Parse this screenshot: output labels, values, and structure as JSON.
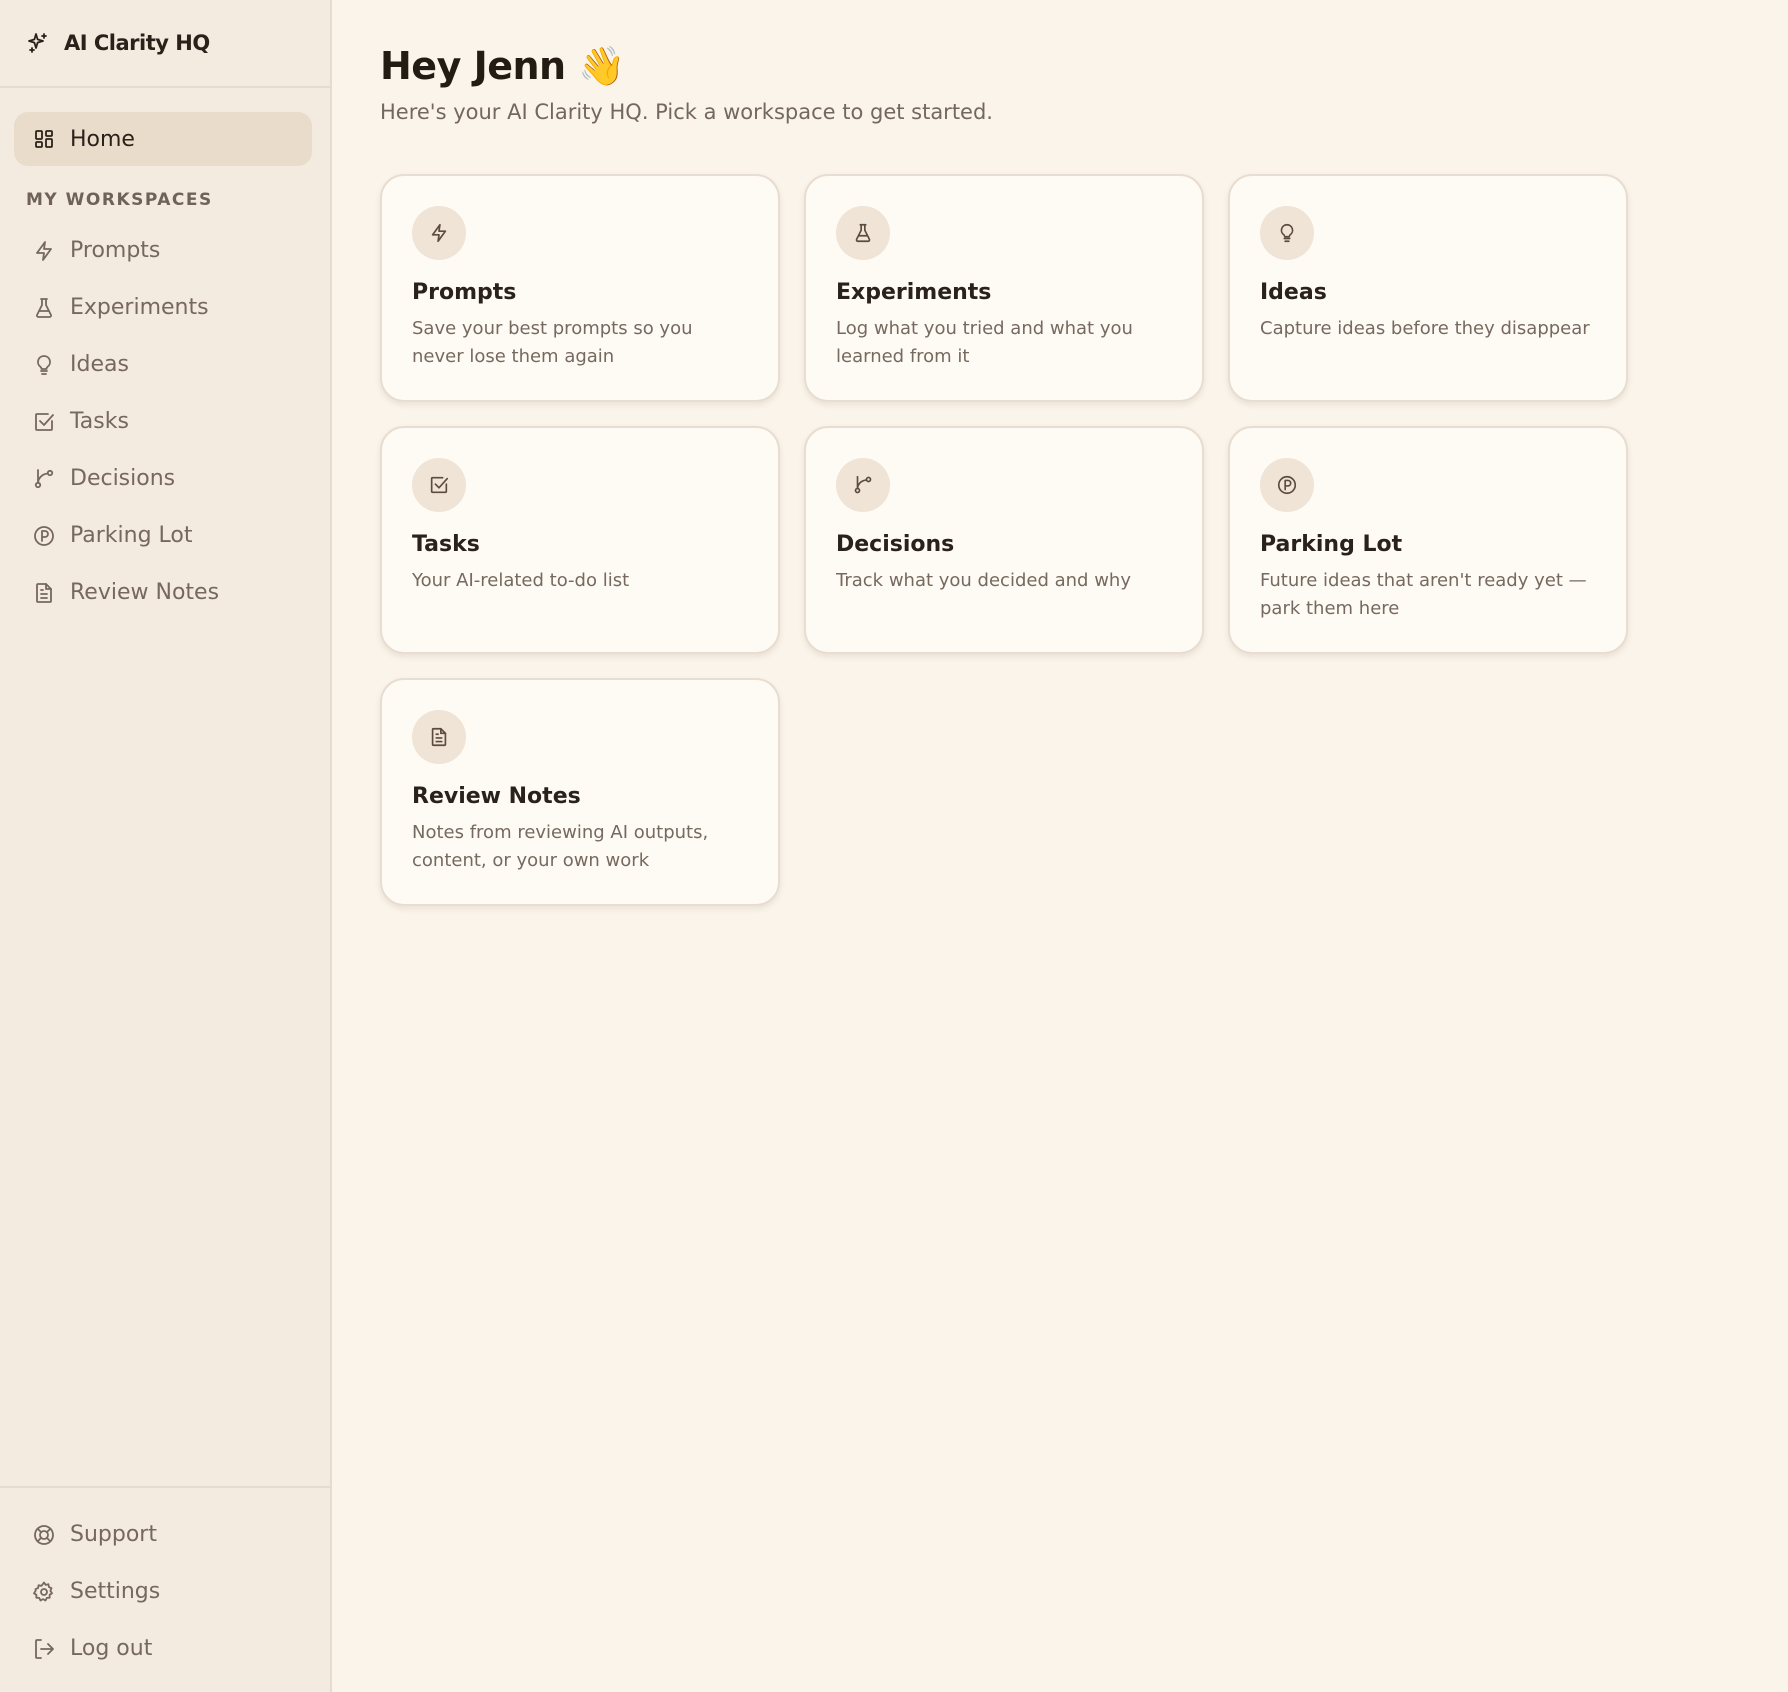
{
  "brand": {
    "name": "AI Clarity HQ",
    "icon": "sparkles-icon"
  },
  "sidebar": {
    "home": {
      "label": "Home",
      "icon": "grid-icon"
    },
    "section_label": "MY WORKSPACES",
    "items": [
      {
        "label": "Prompts",
        "icon": "zap-icon"
      },
      {
        "label": "Experiments",
        "icon": "flask-icon"
      },
      {
        "label": "Ideas",
        "icon": "lightbulb-icon"
      },
      {
        "label": "Tasks",
        "icon": "check-square-icon"
      },
      {
        "label": "Decisions",
        "icon": "git-branch-icon"
      },
      {
        "label": "Parking Lot",
        "icon": "parking-icon"
      },
      {
        "label": "Review Notes",
        "icon": "file-text-icon"
      }
    ],
    "footer": [
      {
        "label": "Support",
        "icon": "life-buoy-icon"
      },
      {
        "label": "Settings",
        "icon": "gear-icon"
      },
      {
        "label": "Log out",
        "icon": "log-out-icon"
      }
    ]
  },
  "main": {
    "greeting": "Hey Jenn 👋",
    "subtitle": "Here's your AI Clarity HQ. Pick a workspace to get started.",
    "cards": [
      {
        "title": "Prompts",
        "description": "Save your best prompts so you never lose them again",
        "icon": "zap-icon"
      },
      {
        "title": "Experiments",
        "description": "Log what you tried and what you learned from it",
        "icon": "flask-icon"
      },
      {
        "title": "Ideas",
        "description": "Capture ideas before they disappear",
        "icon": "lightbulb-icon"
      },
      {
        "title": "Tasks",
        "description": "Your AI-related to-do list",
        "icon": "check-square-icon"
      },
      {
        "title": "Decisions",
        "description": "Track what you decided and why",
        "icon": "git-branch-icon"
      },
      {
        "title": "Parking Lot",
        "description": "Future ideas that aren't ready yet — park them here",
        "icon": "parking-icon"
      },
      {
        "title": "Review Notes",
        "description": "Notes from reviewing AI outputs, content, or your own work",
        "icon": "file-text-icon"
      }
    ]
  },
  "colors": {
    "background": "#faf4ea",
    "sidebar": "#f3ebe0",
    "active_item": "#e9dccb",
    "card": "#fefaf4",
    "text_primary": "#2a211b",
    "text_muted": "#76685d"
  }
}
